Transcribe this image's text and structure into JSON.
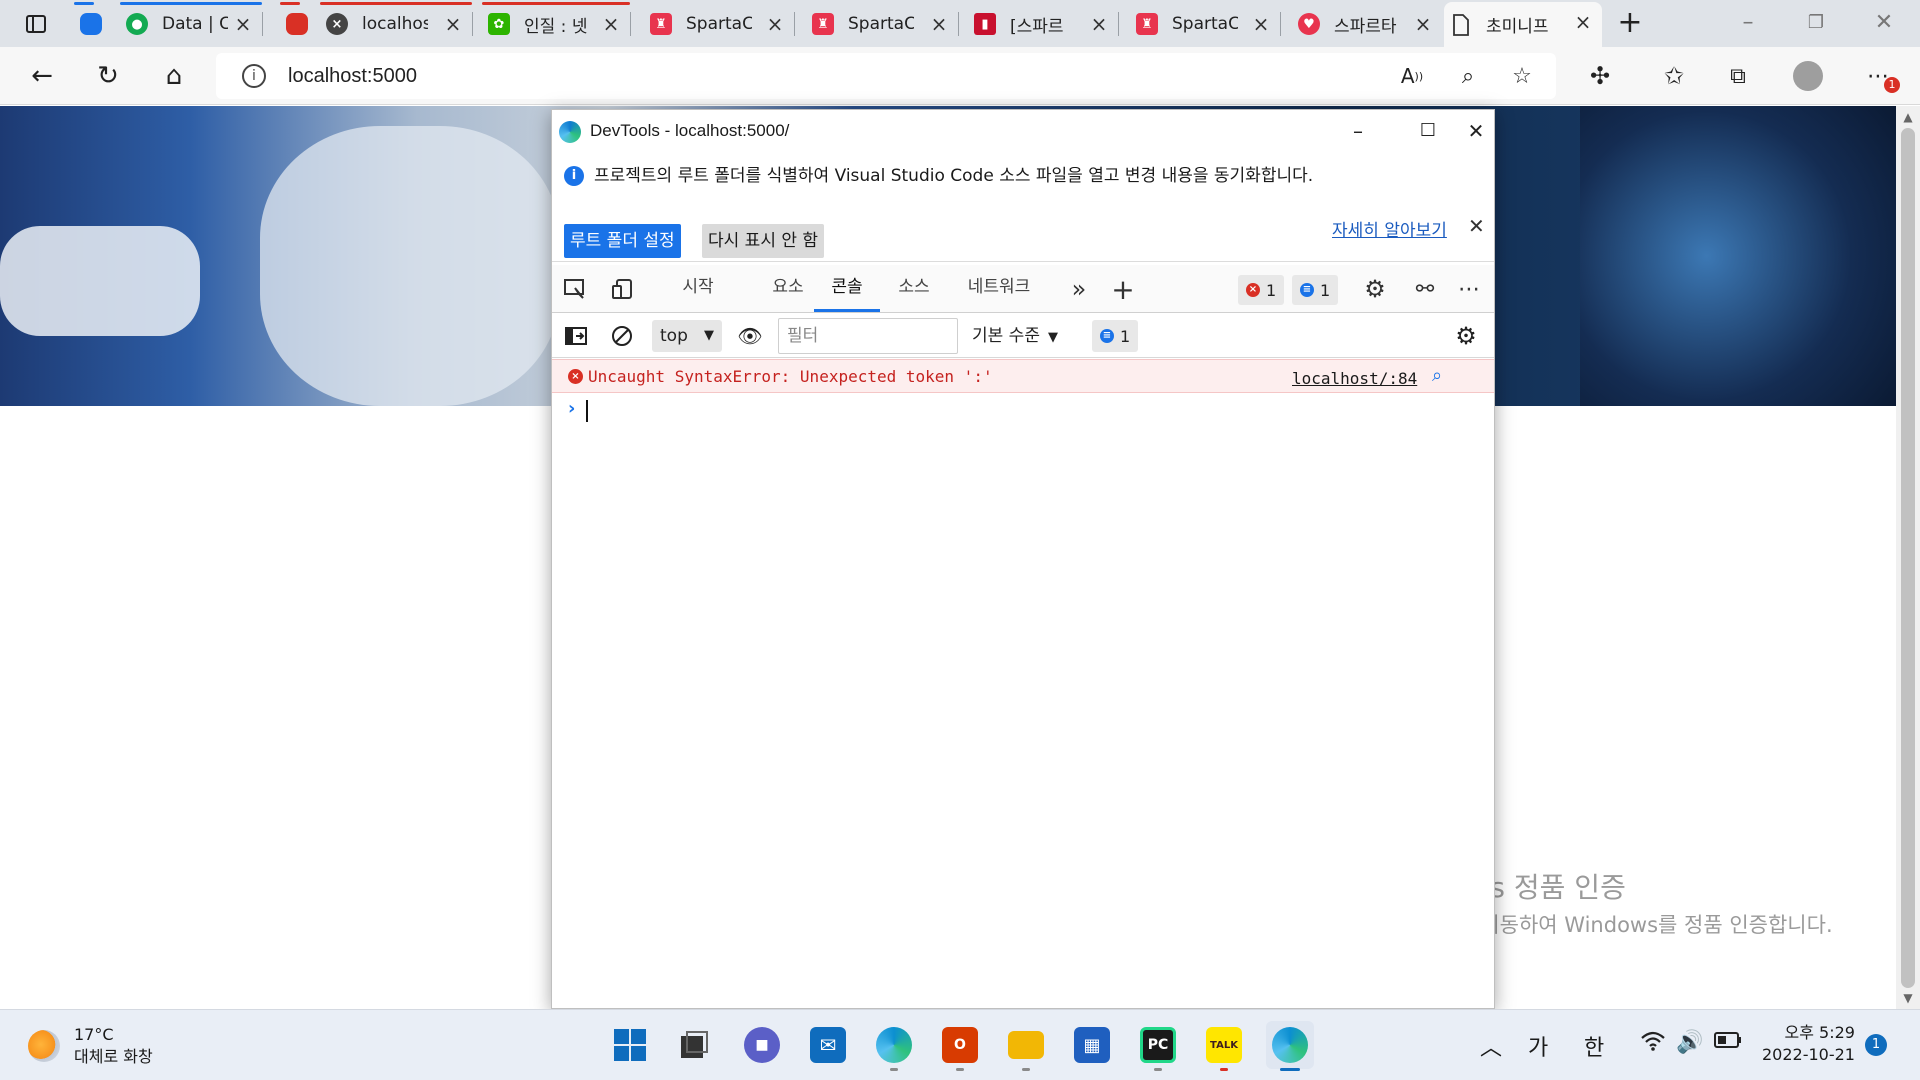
{
  "browser": {
    "tabs": [
      {
        "title": "",
        "favicon_color": "#1a73e8",
        "accent": "#1a73e8"
      },
      {
        "title": "Data | C",
        "favicon_color": "#13aa52",
        "accent": "#1a73e8"
      },
      {
        "title": "",
        "favicon_color": "#d93025",
        "accent": "#d93025"
      },
      {
        "title": "localhos",
        "favicon_color": "#444444",
        "accent": "#d93025"
      },
      {
        "title": "인질 : 넷",
        "favicon_color": "#2db400",
        "accent": "#d93025"
      },
      {
        "title": "SpartaC",
        "favicon_color": "#e8344e",
        "accent": ""
      },
      {
        "title": "SpartaC",
        "favicon_color": "#e8344e",
        "accent": ""
      },
      {
        "title": "[스파르",
        "favicon_color": "#c8102e",
        "accent": ""
      },
      {
        "title": "SpartaC",
        "favicon_color": "#e8344e",
        "accent": ""
      },
      {
        "title": "스파르타",
        "favicon_color": "#e8344e",
        "accent": ""
      },
      {
        "title": "초미니프",
        "favicon_color": "#555555",
        "accent": ""
      }
    ],
    "new_tab_glyph": "+",
    "address": "localhost:5000",
    "address_info_glyph": "i",
    "profile_badge": "1"
  },
  "devtools": {
    "title": "DevTools - localhost:5000/",
    "infobar": {
      "message": "프로젝트의 루트 폴더를 식별하여 Visual Studio Code 소스 파일을 열고 변경 내용을 동기화합니다.",
      "learn_more": "자세히 알아보기",
      "primary_button": "루트 폴더 설정",
      "secondary_button": "다시 표시 안 함"
    },
    "tabs": [
      "시작",
      "요소",
      "콘솔",
      "소스",
      "네트워크"
    ],
    "active_tab": "콘솔",
    "error_count": "1",
    "message_count": "1",
    "console_bar": {
      "context": "top",
      "filter_placeholder": "필터",
      "levels": "기본 수준",
      "issues_count": "1"
    },
    "error": {
      "message": "Uncaught SyntaxError: Unexpected token ':'",
      "source": "localhost/:84"
    },
    "prompt_glyph": "›"
  },
  "page": {
    "activation_title": "Windows 정품 인증",
    "activation_text": "[설정]으로 이동하여 Windows를 정품 인증합니다."
  },
  "taskbar": {
    "weather_temp": "17°C",
    "weather_desc": "대체로 화창",
    "ime_1": "가",
    "ime_2": "한",
    "time": "오후 5:29",
    "date": "2022-10-21",
    "notifications": "1",
    "apps": [
      {
        "name": "start",
        "color": "#0f6cbd"
      },
      {
        "name": "task-view",
        "color": "#333333"
      },
      {
        "name": "teams-chat",
        "color": "#5b5fc7"
      },
      {
        "name": "mail",
        "color": "#0f6cbd"
      },
      {
        "name": "edge",
        "color": "#0c8fd1"
      },
      {
        "name": "office",
        "color": "#d83b01"
      },
      {
        "name": "file-explorer",
        "color": "#f2b705"
      },
      {
        "name": "store",
        "color": "#1f5fbf"
      },
      {
        "name": "pycharm",
        "color": "#1a1a1a"
      },
      {
        "name": "kakaotalk",
        "color": "#ffe600"
      },
      {
        "name": "edge-devtools",
        "color": "#0c8fd1"
      }
    ]
  }
}
